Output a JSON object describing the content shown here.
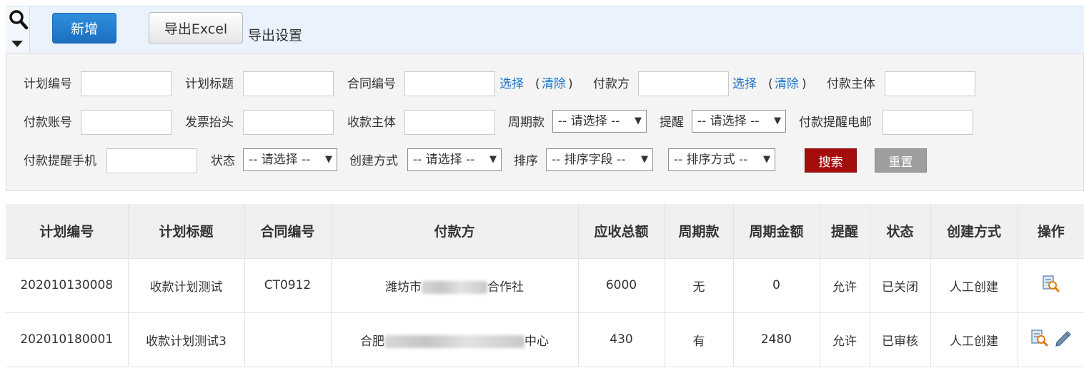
{
  "toolbar": {
    "add_label": "新增",
    "export_excel_label": "导出Excel",
    "export_settings_label": "导出设置"
  },
  "filters": {
    "plan_no": {
      "label": "计划编号",
      "value": ""
    },
    "plan_title": {
      "label": "计划标题",
      "value": ""
    },
    "contract_no": {
      "label": "合同编号",
      "value": "",
      "select": "选择",
      "clear": "清除"
    },
    "payer": {
      "label": "付款方",
      "value": "",
      "select": "选择",
      "clear": "清除"
    },
    "payer_entity": {
      "label": "付款主体",
      "value": ""
    },
    "pay_account": {
      "label": "付款账号",
      "value": ""
    },
    "invoice_title": {
      "label": "发票抬头",
      "value": ""
    },
    "receiver_entity": {
      "label": "收款主体",
      "value": ""
    },
    "periodic": {
      "label": "周期款",
      "value": "-- 请选择 --"
    },
    "remind": {
      "label": "提醒",
      "value": "-- 请选择 --"
    },
    "remind_email": {
      "label": "付款提醒电邮",
      "value": ""
    },
    "remind_phone": {
      "label": "付款提醒手机",
      "value": ""
    },
    "status": {
      "label": "状态",
      "value": "-- 请选择 --"
    },
    "create_method": {
      "label": "创建方式",
      "value": "-- 请选择 --"
    },
    "sort": {
      "label": "排序",
      "field_value": "-- 排序字段 --",
      "order_value": "-- 排序方式 --"
    },
    "search_label": "搜索",
    "reset_label": "重置"
  },
  "table": {
    "columns": [
      "计划编号",
      "计划标题",
      "合同编号",
      "付款方",
      "应收总额",
      "周期款",
      "周期金额",
      "提醒",
      "状态",
      "创建方式",
      "操作"
    ],
    "rows": [
      {
        "plan_no": "202010130008",
        "title": "收款计划测试",
        "contract_no": "CT0912",
        "payer_prefix": "潍坊市",
        "payer_suffix": "合作社",
        "total": "6000",
        "periodic": "无",
        "period_amount": "0",
        "remind": "允许",
        "status": "已关闭",
        "create_method": "人工创建"
      },
      {
        "plan_no": "202010180001",
        "title": "收款计划测试3",
        "contract_no": "",
        "payer_prefix": "合肥",
        "payer_suffix": "中心",
        "total": "430",
        "periodic": "有",
        "period_amount": "2480",
        "remind": "允许",
        "status": "已审核",
        "create_method": "人工创建"
      }
    ]
  },
  "icons": {
    "search": "search-icon",
    "view": "view-detail-icon",
    "edit": "edit-pencil-icon"
  },
  "colors": {
    "primary": "#1c6fc0",
    "search_button": "#a50d0d",
    "reset_button": "#9e9e9e",
    "link": "#1a73c9"
  }
}
